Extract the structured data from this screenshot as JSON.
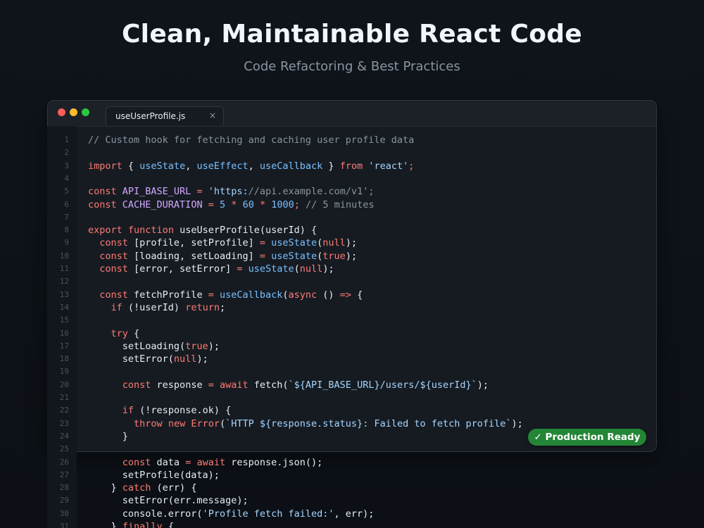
{
  "header": {
    "title": "Clean, Maintainable React Code",
    "subtitle": "Code Refactoring & Best Practices"
  },
  "window": {
    "tab_name": "useUserProfile.js",
    "tab_close": "×"
  },
  "badge": {
    "label": "✓ Production Ready",
    "color": "#238636"
  },
  "colors": {
    "comment": "#8b949e",
    "keyword": "#ff7b72",
    "function": "#79c0ff",
    "string": "#a5d6ff",
    "constant": "#d2a8ff",
    "text": "#e6edf3"
  },
  "code_lines": [
    {
      "n": "1",
      "tokens": [
        {
          "t": "comment",
          "v": "// Custom hook for fetching and caching user profile data"
        }
      ]
    },
    {
      "n": "2",
      "tokens": []
    },
    {
      "n": "3",
      "tokens": [
        {
          "t": "keyword",
          "v": "import"
        },
        {
          "t": "plain",
          "v": " { "
        },
        {
          "t": "fn",
          "v": "useState"
        },
        {
          "t": "plain",
          "v": ", "
        },
        {
          "t": "fn",
          "v": "useEffect"
        },
        {
          "t": "plain",
          "v": ", "
        },
        {
          "t": "fn",
          "v": "useCallback"
        },
        {
          "t": "plain",
          "v": " } "
        },
        {
          "t": "keyword",
          "v": "from"
        },
        {
          "t": "plain",
          "v": " "
        },
        {
          "t": "string",
          "v": "'react'"
        },
        {
          "t": "keyword",
          "v": ";"
        }
      ]
    },
    {
      "n": "4",
      "tokens": []
    },
    {
      "n": "5",
      "tokens": [
        {
          "t": "keyword",
          "v": "const"
        },
        {
          "t": "plain",
          "v": " "
        },
        {
          "t": "const",
          "v": "API_BASE_URL"
        },
        {
          "t": "plain",
          "v": " "
        },
        {
          "t": "op",
          "v": "="
        },
        {
          "t": "plain",
          "v": " "
        },
        {
          "t": "string",
          "v": "'https:"
        },
        {
          "t": "comment",
          "v": "//api.example.com/v1';"
        }
      ]
    },
    {
      "n": "6",
      "tokens": [
        {
          "t": "keyword",
          "v": "const"
        },
        {
          "t": "plain",
          "v": " "
        },
        {
          "t": "const",
          "v": "CACHE_DURATION"
        },
        {
          "t": "plain",
          "v": " "
        },
        {
          "t": "op",
          "v": "="
        },
        {
          "t": "plain",
          "v": " "
        },
        {
          "t": "number",
          "v": "5"
        },
        {
          "t": "plain",
          "v": " "
        },
        {
          "t": "op",
          "v": "*"
        },
        {
          "t": "plain",
          "v": " "
        },
        {
          "t": "number",
          "v": "60"
        },
        {
          "t": "plain",
          "v": " "
        },
        {
          "t": "op",
          "v": "*"
        },
        {
          "t": "plain",
          "v": " "
        },
        {
          "t": "number",
          "v": "1000"
        },
        {
          "t": "keyword",
          "v": ";"
        },
        {
          "t": "plain",
          "v": " "
        },
        {
          "t": "comment",
          "v": "// 5 minutes"
        }
      ]
    },
    {
      "n": "7",
      "tokens": []
    },
    {
      "n": "8",
      "tokens": [
        {
          "t": "keyword",
          "v": "export"
        },
        {
          "t": "plain",
          "v": " "
        },
        {
          "t": "keyword",
          "v": "function"
        },
        {
          "t": "plain",
          "v": " useUserProfile(userId) {"
        }
      ]
    },
    {
      "n": "9",
      "tokens": [
        {
          "t": "plain",
          "v": "  "
        },
        {
          "t": "keyword",
          "v": "const"
        },
        {
          "t": "plain",
          "v": " [profile, setProfile] "
        },
        {
          "t": "op",
          "v": "="
        },
        {
          "t": "plain",
          "v": " "
        },
        {
          "t": "fn",
          "v": "useState"
        },
        {
          "t": "plain",
          "v": "("
        },
        {
          "t": "keyword",
          "v": "null"
        },
        {
          "t": "plain",
          "v": ");"
        }
      ]
    },
    {
      "n": "10",
      "tokens": [
        {
          "t": "plain",
          "v": "  "
        },
        {
          "t": "keyword",
          "v": "const"
        },
        {
          "t": "plain",
          "v": " [loading, setLoading] "
        },
        {
          "t": "op",
          "v": "="
        },
        {
          "t": "plain",
          "v": " "
        },
        {
          "t": "fn",
          "v": "useState"
        },
        {
          "t": "plain",
          "v": "("
        },
        {
          "t": "keyword",
          "v": "true"
        },
        {
          "t": "plain",
          "v": ");"
        }
      ]
    },
    {
      "n": "11",
      "tokens": [
        {
          "t": "plain",
          "v": "  "
        },
        {
          "t": "keyword",
          "v": "const"
        },
        {
          "t": "plain",
          "v": " [error, setError] "
        },
        {
          "t": "op",
          "v": "="
        },
        {
          "t": "plain",
          "v": " "
        },
        {
          "t": "fn",
          "v": "useState"
        },
        {
          "t": "plain",
          "v": "("
        },
        {
          "t": "keyword",
          "v": "null"
        },
        {
          "t": "plain",
          "v": ");"
        }
      ]
    },
    {
      "n": "12",
      "tokens": []
    },
    {
      "n": "13",
      "tokens": [
        {
          "t": "plain",
          "v": "  "
        },
        {
          "t": "keyword",
          "v": "const"
        },
        {
          "t": "plain",
          "v": " fetchProfile "
        },
        {
          "t": "op",
          "v": "="
        },
        {
          "t": "plain",
          "v": " "
        },
        {
          "t": "fn",
          "v": "useCallback"
        },
        {
          "t": "plain",
          "v": "("
        },
        {
          "t": "keyword",
          "v": "async"
        },
        {
          "t": "plain",
          "v": " () "
        },
        {
          "t": "op",
          "v": "=>"
        },
        {
          "t": "plain",
          "v": " {"
        }
      ]
    },
    {
      "n": "14",
      "tokens": [
        {
          "t": "plain",
          "v": "    "
        },
        {
          "t": "keyword",
          "v": "if"
        },
        {
          "t": "plain",
          "v": " (!userId) "
        },
        {
          "t": "keyword",
          "v": "return"
        },
        {
          "t": "plain",
          "v": ";"
        }
      ]
    },
    {
      "n": "15",
      "tokens": []
    },
    {
      "n": "16",
      "tokens": [
        {
          "t": "plain",
          "v": "    "
        },
        {
          "t": "keyword",
          "v": "try"
        },
        {
          "t": "plain",
          "v": " {"
        }
      ]
    },
    {
      "n": "17",
      "tokens": [
        {
          "t": "plain",
          "v": "      setLoading("
        },
        {
          "t": "keyword",
          "v": "true"
        },
        {
          "t": "plain",
          "v": ");"
        }
      ]
    },
    {
      "n": "18",
      "tokens": [
        {
          "t": "plain",
          "v": "      setError("
        },
        {
          "t": "keyword",
          "v": "null"
        },
        {
          "t": "plain",
          "v": ");"
        }
      ]
    },
    {
      "n": "19",
      "tokens": []
    },
    {
      "n": "20",
      "tokens": [
        {
          "t": "plain",
          "v": "      "
        },
        {
          "t": "keyword",
          "v": "const"
        },
        {
          "t": "plain",
          "v": " response "
        },
        {
          "t": "op",
          "v": "="
        },
        {
          "t": "plain",
          "v": " "
        },
        {
          "t": "keyword",
          "v": "await"
        },
        {
          "t": "plain",
          "v": " fetch("
        },
        {
          "t": "string",
          "v": "`${API_BASE_URL}/users/${userId}`"
        },
        {
          "t": "plain",
          "v": ");"
        }
      ]
    },
    {
      "n": "21",
      "tokens": []
    },
    {
      "n": "22",
      "tokens": [
        {
          "t": "plain",
          "v": "      "
        },
        {
          "t": "keyword",
          "v": "if"
        },
        {
          "t": "plain",
          "v": " (!response.ok) {"
        }
      ]
    },
    {
      "n": "23",
      "tokens": [
        {
          "t": "plain",
          "v": "        "
        },
        {
          "t": "keyword",
          "v": "throw"
        },
        {
          "t": "plain",
          "v": " "
        },
        {
          "t": "keyword",
          "v": "new"
        },
        {
          "t": "plain",
          "v": " "
        },
        {
          "t": "keyword",
          "v": "Error"
        },
        {
          "t": "plain",
          "v": "("
        },
        {
          "t": "string",
          "v": "`HTTP ${response.status}: Failed to fetch profile`"
        },
        {
          "t": "plain",
          "v": ");"
        }
      ]
    },
    {
      "n": "24",
      "tokens": [
        {
          "t": "plain",
          "v": "      }"
        }
      ]
    },
    {
      "n": "25",
      "tokens": []
    },
    {
      "n": "26",
      "tokens": [
        {
          "t": "plain",
          "v": "      "
        },
        {
          "t": "keyword",
          "v": "const"
        },
        {
          "t": "plain",
          "v": " data "
        },
        {
          "t": "op",
          "v": "="
        },
        {
          "t": "plain",
          "v": " "
        },
        {
          "t": "keyword",
          "v": "await"
        },
        {
          "t": "plain",
          "v": " response.json();"
        }
      ]
    },
    {
      "n": "27",
      "tokens": [
        {
          "t": "plain",
          "v": "      setProfile(data);"
        }
      ]
    },
    {
      "n": "28",
      "tokens": [
        {
          "t": "plain",
          "v": "    } "
        },
        {
          "t": "keyword",
          "v": "catch"
        },
        {
          "t": "plain",
          "v": " (err) {"
        }
      ]
    },
    {
      "n": "29",
      "tokens": [
        {
          "t": "plain",
          "v": "      setError(err.message);"
        }
      ]
    },
    {
      "n": "30",
      "tokens": [
        {
          "t": "plain",
          "v": "      console.error("
        },
        {
          "t": "string",
          "v": "'Profile fetch failed:'"
        },
        {
          "t": "plain",
          "v": ", err);"
        }
      ]
    },
    {
      "n": "31",
      "tokens": [
        {
          "t": "plain",
          "v": "    } "
        },
        {
          "t": "keyword",
          "v": "finally"
        },
        {
          "t": "plain",
          "v": " {"
        }
      ]
    }
  ]
}
